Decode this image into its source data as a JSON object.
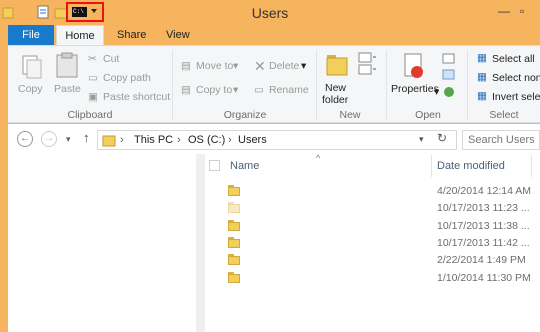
{
  "window": {
    "title": "Users"
  },
  "qat": {
    "cmd_label": "C:\\"
  },
  "tabs": {
    "file": "File",
    "home": "Home",
    "share": "Share",
    "view": "View"
  },
  "ribbon": {
    "clipboard": {
      "copy": "Copy",
      "paste": "Paste",
      "cut": "Cut",
      "copy_path": "Copy path",
      "paste_shortcut": "Paste shortcut",
      "label": "Clipboard"
    },
    "organize": {
      "move_to": "Move to",
      "copy_to": "Copy to",
      "delete": "Delete",
      "rename": "Rename",
      "label": "Organize"
    },
    "new": {
      "new_folder_1": "New",
      "new_folder_2": "folder",
      "label": "New"
    },
    "open": {
      "properties": "Properties",
      "label": "Open"
    },
    "select": {
      "select_all": "Select all",
      "select_none": "Select non",
      "invert": "Invert selecti",
      "label": "Select"
    }
  },
  "address": {
    "crumbs": [
      "This PC",
      "OS (C:)",
      "Users"
    ],
    "search_placeholder": "Search Users"
  },
  "columns": {
    "name": "Name",
    "date_modified": "Date modified"
  },
  "rows": [
    {
      "name": "",
      "date": "4/20/2014 12:14 AM",
      "faded": false
    },
    {
      "name": "",
      "date": "10/17/2013 11:23 ...",
      "faded": true
    },
    {
      "name": "",
      "date": "10/17/2013 11:38 ...",
      "faded": false
    },
    {
      "name": "",
      "date": "10/17/2013 11:42 ...",
      "faded": false
    },
    {
      "name": "",
      "date": "2/22/2014 1:49 PM",
      "faded": false
    },
    {
      "name": "",
      "date": "1/10/2014 11:30 PM",
      "faded": false
    }
  ]
}
